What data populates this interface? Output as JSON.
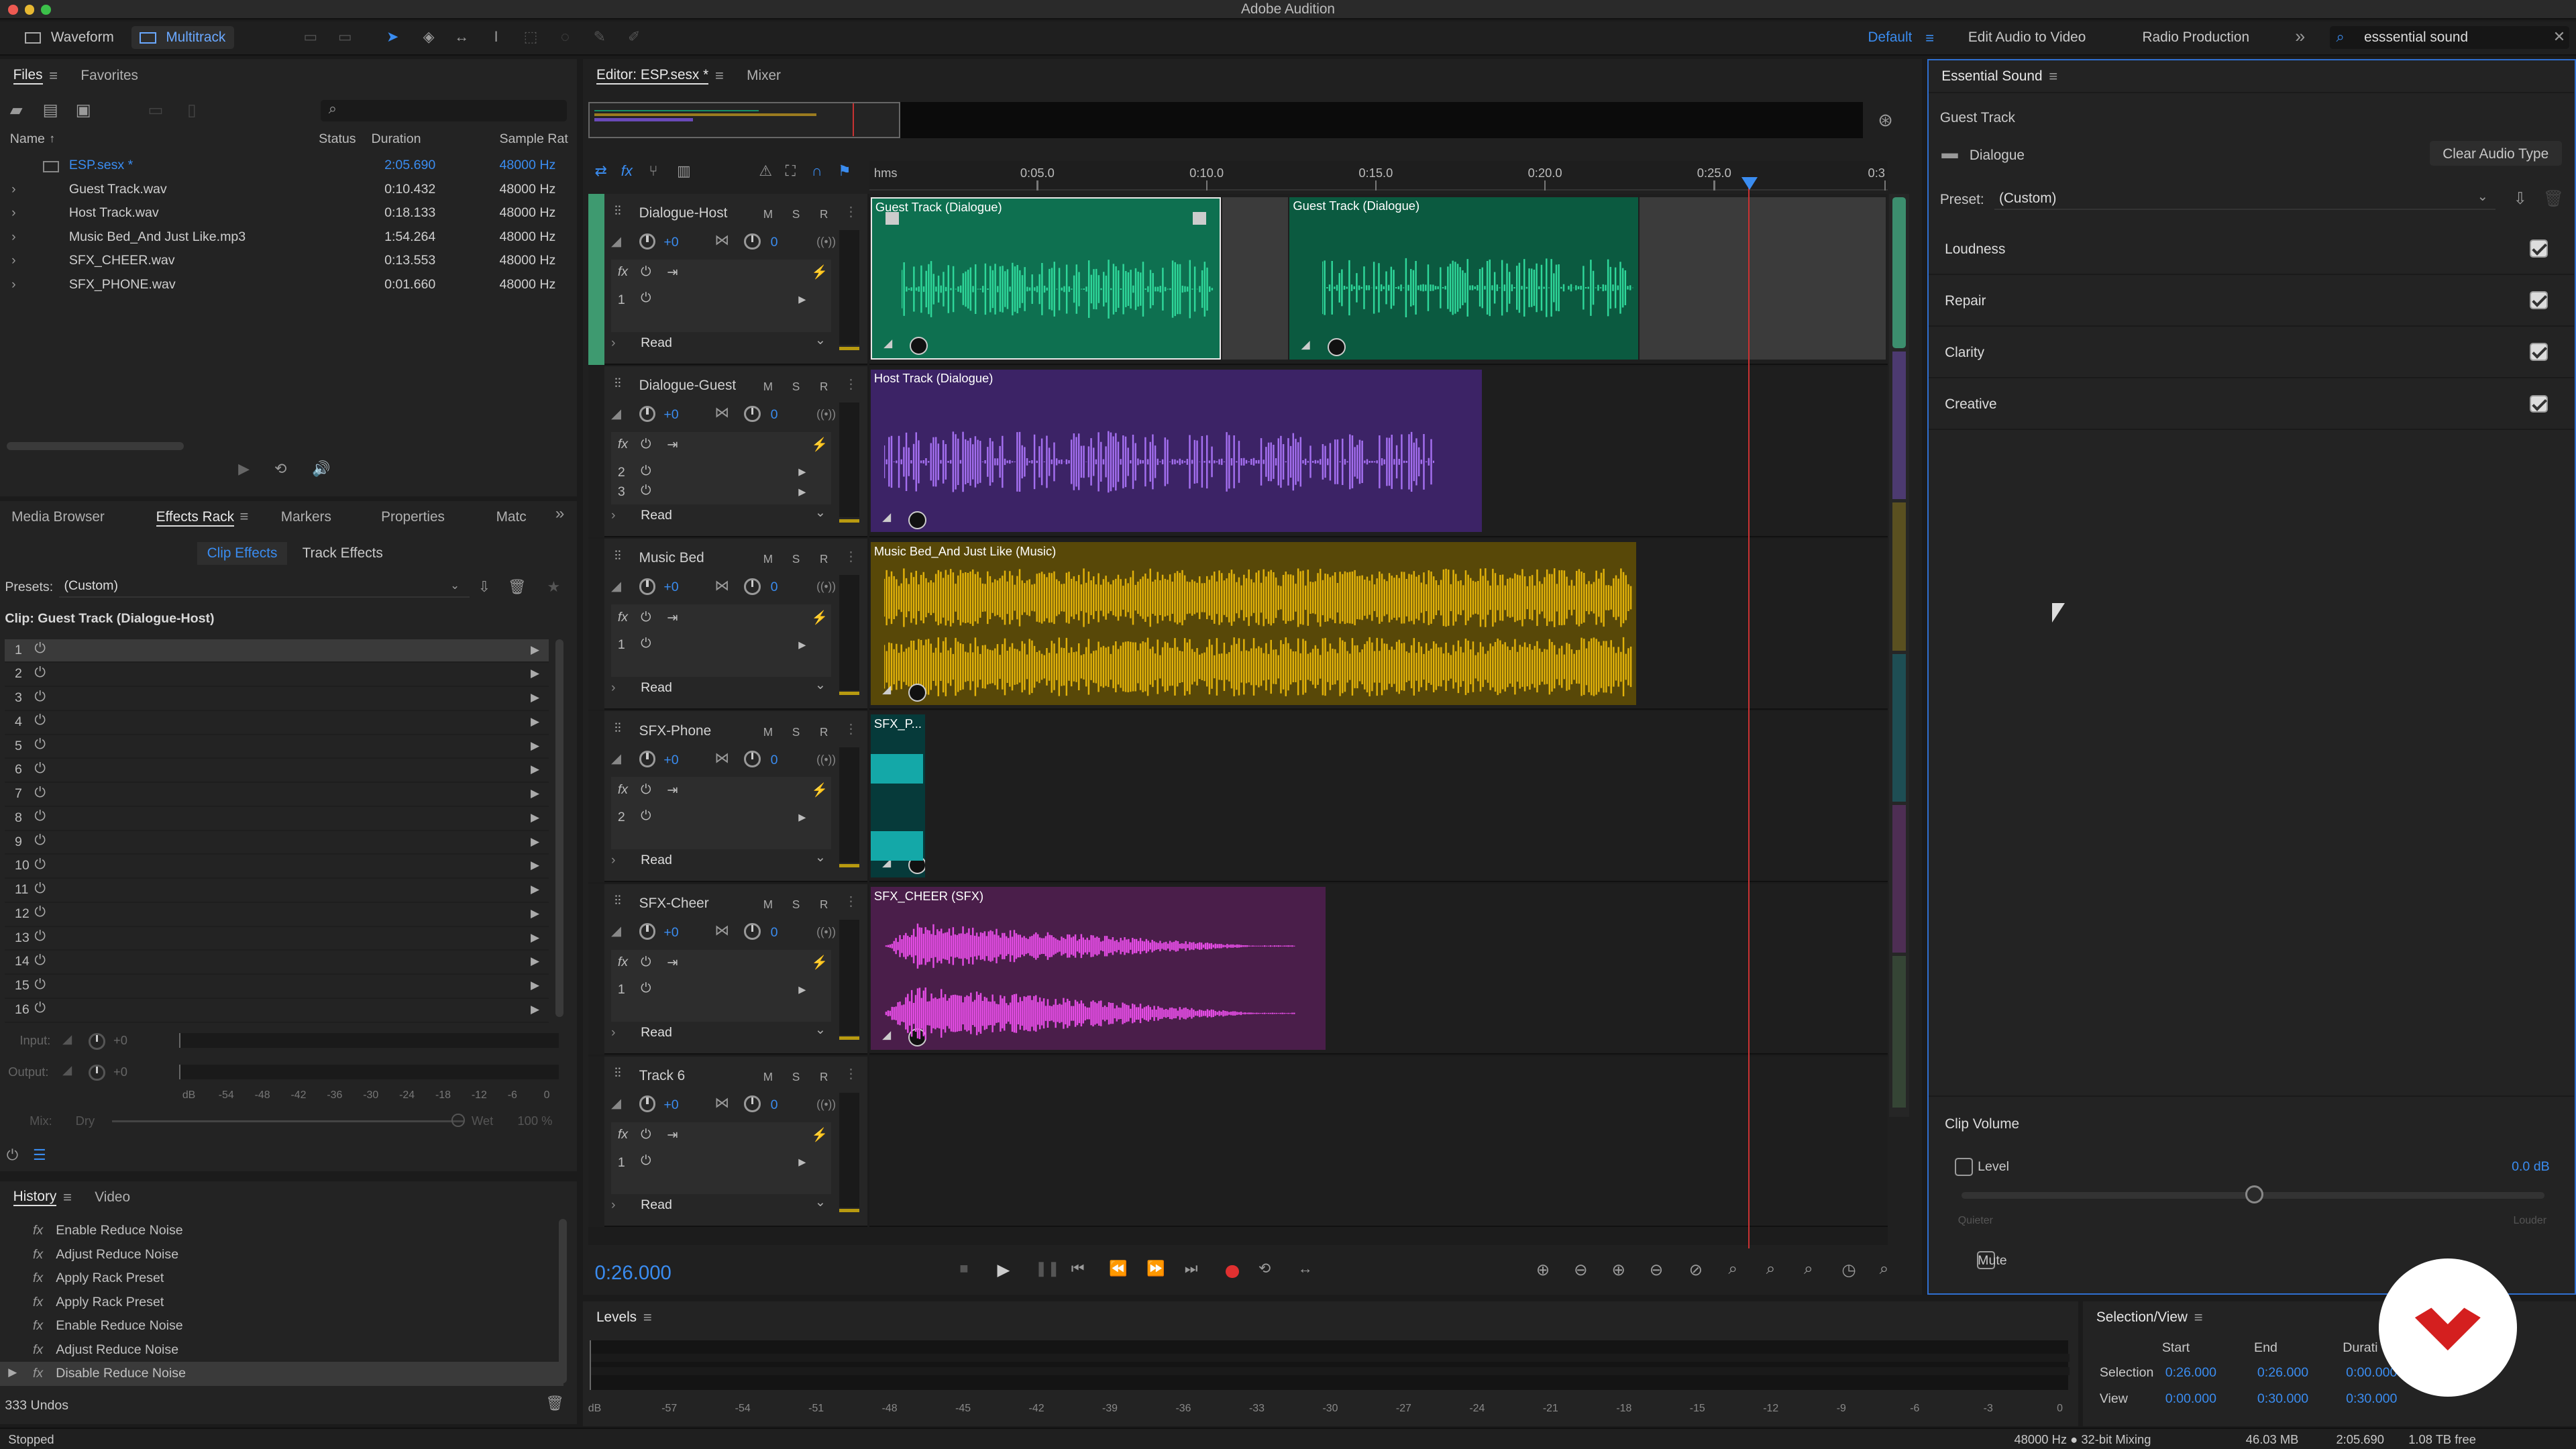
{
  "app": {
    "title": "Adobe Audition",
    "status": "Stopped",
    "undos": "333 Undos"
  },
  "toolbar": {
    "waveform": "Waveform",
    "multitrack": "Multitrack",
    "workspace_default": "Default",
    "edit_audio_video": "Edit Audio to Video",
    "radio_production": "Radio Production",
    "search_value": "esssential sound"
  },
  "files": {
    "tab_files": "Files",
    "tab_favorites": "Favorites",
    "columns": {
      "name": "Name",
      "status": "Status",
      "duration": "Duration",
      "sample_rate": "Sample Rat"
    },
    "rows": [
      {
        "name": "ESP.sesx *",
        "duration": "2:05.690",
        "rate": "48000 Hz",
        "active": true
      },
      {
        "name": "Guest Track.wav",
        "duration": "0:10.432",
        "rate": "48000 Hz"
      },
      {
        "name": "Host Track.wav",
        "duration": "0:18.133",
        "rate": "48000 Hz"
      },
      {
        "name": "Music Bed_And Just Like.mp3",
        "duration": "1:54.264",
        "rate": "48000 Hz"
      },
      {
        "name": "SFX_CHEER.wav",
        "duration": "0:13.553",
        "rate": "48000 Hz"
      },
      {
        "name": "SFX_PHONE.wav",
        "duration": "0:01.660",
        "rate": "48000 Hz"
      }
    ]
  },
  "effects": {
    "tabs": [
      "Media Browser",
      "Effects Rack",
      "Markers",
      "Properties",
      "Matc"
    ],
    "clip_effects": "Clip Effects",
    "track_effects": "Track Effects",
    "presets_label": "Presets:",
    "preset_value": "(Custom)",
    "clip_label": "Clip: Guest Track (Dialogue-Host)",
    "slots": [
      "1",
      "2",
      "3",
      "4",
      "5",
      "6",
      "7",
      "8",
      "9",
      "10",
      "11",
      "12",
      "13",
      "14",
      "15",
      "16"
    ],
    "input_label": "Input:",
    "input_val": "+0",
    "output_label": "Output:",
    "output_val": "+0",
    "meter_ticks": [
      "dB",
      "-54",
      "-48",
      "-42",
      "-36",
      "-30",
      "-24",
      "-18",
      "-12",
      "-6",
      "0"
    ],
    "mix_label": "Mix:",
    "dry": "Dry",
    "wet": "Wet",
    "wet_pct": "100 %"
  },
  "history": {
    "tab_history": "History",
    "tab_video": "Video",
    "items": [
      "Enable Reduce Noise",
      "Adjust Reduce Noise",
      "Apply Rack Preset",
      "Apply Rack Preset",
      "Enable Reduce Noise",
      "Adjust Reduce Noise",
      "Disable Reduce Noise"
    ]
  },
  "editor": {
    "tab_editor": "Editor: ESP.sesx *",
    "tab_mixer": "Mixer",
    "ruler": [
      "hms",
      "0:05.0",
      "0:10.0",
      "0:15.0",
      "0:20.0",
      "0:25.0",
      "0:3"
    ],
    "time": "0:26.000",
    "tracks": [
      {
        "name": "Dialogue-Host",
        "vol": "+0",
        "pan": "0",
        "slots": [
          "1"
        ],
        "mode": "Read",
        "color": "#1fa06c"
      },
      {
        "name": "Dialogue-Guest",
        "vol": "+0",
        "pan": "0",
        "slots": [
          "2",
          "3"
        ],
        "mode": "Read",
        "color": "#7b45c9"
      },
      {
        "name": "Music Bed",
        "vol": "+0",
        "pan": "0",
        "slots": [
          "1"
        ],
        "mode": "Read",
        "color": "#b58f00"
      },
      {
        "name": "SFX-Phone",
        "vol": "+0",
        "pan": "0",
        "slots": [
          "2"
        ],
        "mode": "Read",
        "color": "#14a0a0"
      },
      {
        "name": "SFX-Cheer",
        "vol": "+0",
        "pan": "0",
        "slots": [
          "1"
        ],
        "mode": "Read",
        "color": "#b63cb6"
      },
      {
        "name": "Track 6",
        "vol": "+0",
        "pan": "0",
        "slots": [
          "1"
        ],
        "mode": "Read",
        "color": "#555555"
      }
    ],
    "clips": {
      "c1": "Guest Track (Dialogue)",
      "c2": "Guest Track (Dialogue)",
      "c3": "Host Track (Dialogue)",
      "c4": "Music Bed_And Just Like (Music)",
      "c5": "SFX_P...",
      "c6": "SFX_CHEER (SFX)"
    }
  },
  "levels": {
    "title": "Levels",
    "ticks": [
      "dB",
      "-57",
      "-54",
      "-51",
      "-48",
      "-45",
      "-42",
      "-39",
      "-36",
      "-33",
      "-30",
      "-27",
      "-24",
      "-21",
      "-18",
      "-15",
      "-12",
      "-9",
      "-6",
      "-3",
      "0"
    ]
  },
  "selection_view": {
    "title": "Selection/View",
    "start": "Start",
    "end": "End",
    "duration": "Durati",
    "selection": {
      "label": "Selection",
      "start": "0:26.000",
      "end": "0:26.000",
      "duration": "0:00.000"
    },
    "view": {
      "label": "View",
      "start": "0:00.000",
      "end": "0:30.000",
      "duration": "0:30.000"
    }
  },
  "essential_sound": {
    "title": "Essential Sound",
    "track": "Guest Track",
    "type": "Dialogue",
    "clear": "Clear Audio Type",
    "preset_label": "Preset:",
    "preset_value": "(Custom)",
    "sections": [
      "Loudness",
      "Repair",
      "Clarity",
      "Creative"
    ],
    "clip_volume": "Clip Volume",
    "level": "Level",
    "level_val": "0.0 dB",
    "quieter": "Quieter",
    "louder": "Louder",
    "mute": "Mute"
  },
  "statusbar": {
    "rate": "48000 Hz ● 32-bit Mixing",
    "mem": "46.03 MB",
    "dur": "2:05.690",
    "free": "1.08 TB free"
  },
  "colors": {
    "accent": "#3a8cf0",
    "host_clip": "#0d6e4a",
    "guest_clip": "#3c2366",
    "music_clip": "#5a4a06",
    "cheer_clip": "#4a1e4a",
    "playhead": "#c83232"
  }
}
